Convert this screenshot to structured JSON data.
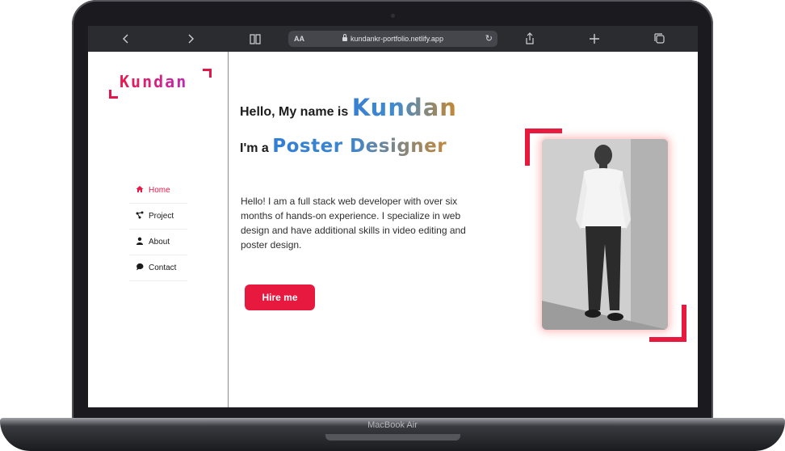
{
  "browser": {
    "back_icon": "chevron-left-icon",
    "forward_icon": "chevron-right-icon",
    "reader_icon": "book-icon",
    "text_size_label": "AA",
    "url": "kundankr-portfolio.netlify.app",
    "reload_icon": "reload-icon",
    "share_icon": "share-icon",
    "new_tab_icon": "plus-icon",
    "tabs_icon": "tabs-icon"
  },
  "logo": {
    "text": "Kundan"
  },
  "nav": {
    "items": [
      {
        "label": "Home",
        "icon": "home-icon",
        "active": true
      },
      {
        "label": "Project",
        "icon": "project-icon",
        "active": false
      },
      {
        "label": "About",
        "icon": "person-icon",
        "active": false
      },
      {
        "label": "Contact",
        "icon": "chat-icon",
        "active": false
      }
    ]
  },
  "hero": {
    "greeting": "Hello, My name is ",
    "name": "Kundan",
    "role_prefix": "I'm a ",
    "role": "Poster Designer",
    "intro": "Hello! I am a full stack web developer with over six months of hands-on experience. I specialize in web design and have additional skills in video editing and poster design.",
    "button": "Hire me"
  },
  "device": {
    "model": "MacBook Air"
  },
  "colors": {
    "accent": "#e8193f",
    "logo_gradient_start": "#e8194b",
    "logo_gradient_end": "#c02bb0",
    "name_gradient_start": "#3a7fd0",
    "name_gradient_end": "#c7872f"
  }
}
